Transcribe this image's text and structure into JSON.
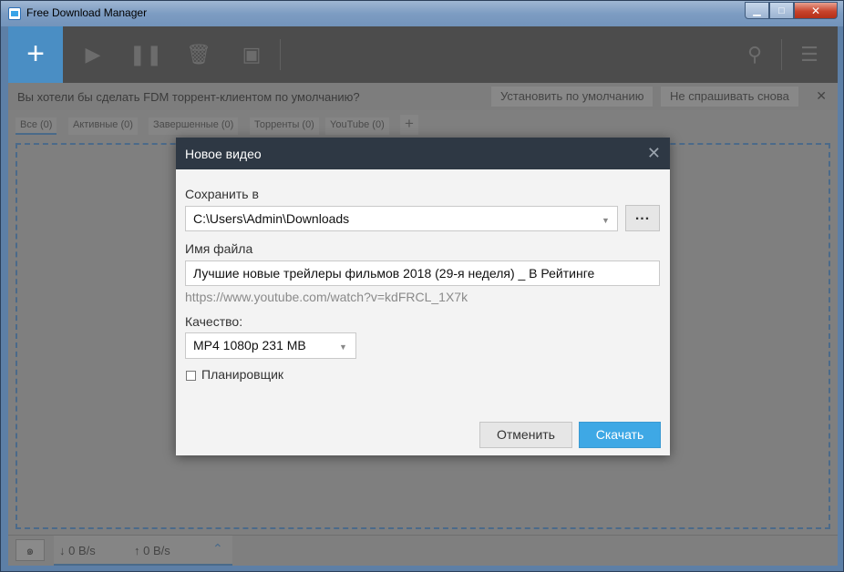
{
  "window": {
    "title": "Free Download Manager"
  },
  "toolbar": {
    "add_icon": "plus-icon",
    "icons": [
      "play-icon",
      "pause-icon",
      "trash-icon",
      "move-folder-icon",
      "search-icon",
      "menu-icon"
    ]
  },
  "notice": {
    "text": "Вы хотели бы сделать FDM торрент-клиентом по умолчанию?",
    "set_default": "Установить по умолчанию",
    "dont_ask": "Не спрашивать снова",
    "close": "✕"
  },
  "tabs": [
    {
      "label": "Все (0)"
    },
    {
      "label": "Активные (0)"
    },
    {
      "label": "Завершенные (0)"
    },
    {
      "label": "Торренты (0)"
    },
    {
      "label": "YouTube (0)"
    }
  ],
  "tab_add": "+",
  "status": {
    "down_speed": "↓  0 B/s",
    "up_speed": "↑ 0 B/s"
  },
  "dialog": {
    "title": "Новое видео",
    "save_label": "Сохранить в",
    "save_path": "C:\\Users\\Admin\\Downloads",
    "browse": "...",
    "filename_label": "Имя файла",
    "filename": "Лучшие новые трейлеры фильмов 2018 (29-я неделя) _ В Рейтинге",
    "url": "https://www.youtube.com/watch?v=kdFRCL_1X7k",
    "quality_label": "Качество:",
    "quality_value": "MP4 1080p 231 MB",
    "scheduler_label": "Планировщик",
    "scheduler_checked": false,
    "cancel": "Отменить",
    "download": "Скачать"
  },
  "colors": {
    "accent": "#3ea8e5",
    "dialog_header": "#2e3844",
    "add_button": "#4a8ec4"
  }
}
